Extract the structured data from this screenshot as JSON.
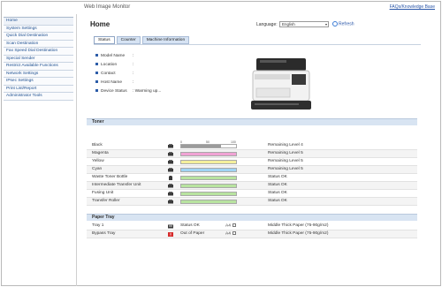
{
  "header": {
    "title": "Web Image Monitor",
    "faq_link": "FAQs/Knowledge Base"
  },
  "sidebar": {
    "items": [
      {
        "label": "Home"
      },
      {
        "label": "System Settings"
      },
      {
        "label": "Quick Dial Destination"
      },
      {
        "label": "Scan Destination"
      },
      {
        "label": "Fax Speed Dial Destination"
      },
      {
        "label": "Special Sender"
      },
      {
        "label": "Restrict Available Functions"
      },
      {
        "label": "Network Settings"
      },
      {
        "label": "IPsec Settings"
      },
      {
        "label": "Print List/Report"
      },
      {
        "label": "Administrator Tools"
      }
    ]
  },
  "main": {
    "page_title": "Home",
    "language_label": "Language:",
    "language_value": "English",
    "refresh_label": "Refresh",
    "tabs": [
      {
        "label": "Status"
      },
      {
        "label": "Counter"
      },
      {
        "label": "Machine Information"
      }
    ],
    "device_info": [
      {
        "label": "Model Name",
        "value": ":"
      },
      {
        "label": "Location",
        "value": ":"
      },
      {
        "label": "Contact",
        "value": ":"
      },
      {
        "label": "Host Name",
        "value": ":"
      },
      {
        "label": "Device Status",
        "value": ": Warming up..."
      }
    ]
  },
  "toner": {
    "header": "Toner",
    "scale": [
      "0",
      "50",
      "100"
    ],
    "rows": [
      {
        "name": "Black",
        "level": 0.72,
        "color": "#9b9b9b",
        "status": "Remaining Level 4"
      },
      {
        "name": "Magenta",
        "level": 1.0,
        "color": "#f0a3d5",
        "status": "Remaining Level 5"
      },
      {
        "name": "Yellow",
        "level": 1.0,
        "color": "#f4ef9c",
        "status": "Remaining Level 5"
      },
      {
        "name": "Cyan",
        "level": 1.0,
        "color": "#9fd3f3",
        "status": "Remaining Level 5"
      },
      {
        "name": "Waste Toner Bottle",
        "level": 1.0,
        "color": "#b8e3a0",
        "status": "Status OK"
      },
      {
        "name": "Intermediate Transfer Unit",
        "level": 1.0,
        "color": "#b8e3a0",
        "status": "Status OK"
      },
      {
        "name": "Fusing Unit",
        "level": 1.0,
        "color": "#b8e3a0",
        "status": "Status OK"
      },
      {
        "name": "Transfer Roller",
        "level": 1.0,
        "color": "#b8e3a0",
        "status": "Status OK"
      }
    ]
  },
  "paper_tray": {
    "header": "Paper Tray",
    "rows": [
      {
        "name": "Tray 1",
        "status": "Status OK",
        "all_label": "A4",
        "paper": "Middle Thick Paper (75-90g/m2)",
        "error": false
      },
      {
        "name": "Bypass Tray",
        "status": "Out of Paper",
        "all_label": "A4",
        "paper": "Middle Thick Paper (75-90g/m2)",
        "error": true
      }
    ]
  }
}
